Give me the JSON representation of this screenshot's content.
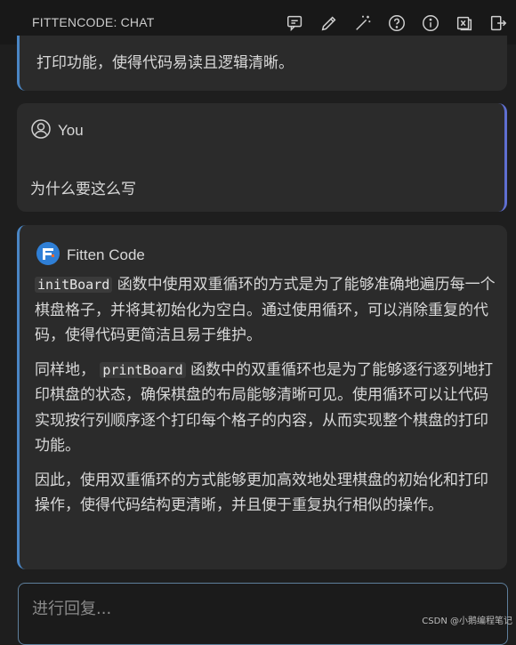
{
  "header": {
    "title": "FITTENCODE: CHAT"
  },
  "toolbar": {
    "icons": [
      "new-chat-icon",
      "edit-icon",
      "magic-wand-icon",
      "help-icon",
      "info-icon",
      "close-panel-icon",
      "export-icon"
    ]
  },
  "prev_message": {
    "tail": "打印功能，使得代码易读且逻辑清晰。"
  },
  "user_message": {
    "author": "You",
    "text": "为什么要这么写"
  },
  "bot_message": {
    "author": "Fitten Code",
    "p1_code": "initBoard",
    "p1_text": "函数中使用双重循环的方式是为了能够准确地遍历每一个棋盘格子，并将其初始化为空白。通过使用循环，可以消除重复的代码，使得代码更简洁且易于维护。",
    "p2_pre": "同样地，",
    "p2_code": "printBoard",
    "p2_text": "函数中的双重循环也是为了能够逐行逐列地打印棋盘的状态，确保棋盘的布局能够清晰可见。使用循环可以让代码实现按行列顺序逐个打印每个格子的内容，从而实现整个棋盘的打印功能。",
    "p3_text": "因此，使用双重循环的方式能够更加高效地处理棋盘的初始化和打印操作，使得代码结构更清晰，并且便于重复执行相似的操作。"
  },
  "reply": {
    "placeholder": "进行回复..."
  },
  "watermark": "CSDN @小鹅编程笔记",
  "colors": {
    "accent_left": "#4a86c5",
    "accent_right": "#5f6fd1",
    "card": "#2b2b2b",
    "background": "#1e1e1e"
  }
}
